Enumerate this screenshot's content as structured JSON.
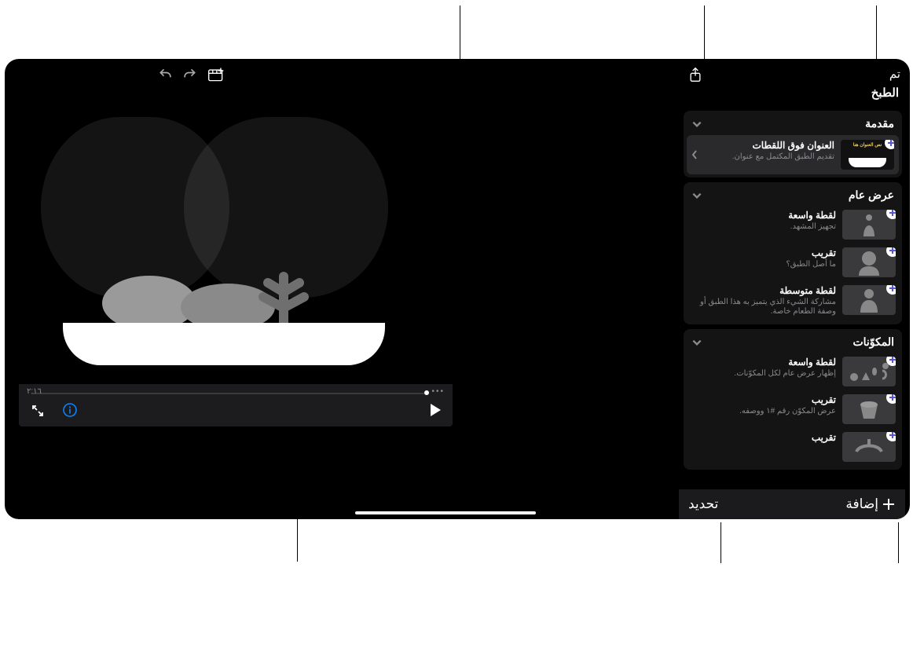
{
  "topbar": {
    "done_label": "تم",
    "project_title": "الطبخ"
  },
  "viewer": {
    "current_time": "٢:١٦",
    "end_marker": "•••"
  },
  "panelbar": {
    "add_label": "إضافة",
    "select_label": "تحديد"
  },
  "groups": [
    {
      "title": "مقدمة",
      "shots": [
        {
          "title": "العنوان فوق اللقطات",
          "sub": "تقديم الطبق المكتمل مع عنوان.",
          "thumb": "title",
          "selected": true
        }
      ]
    },
    {
      "title": "عرض عام",
      "shots": [
        {
          "title": "لقطة واسعة",
          "sub": "تجهيز المشهد.",
          "thumb": "wide"
        },
        {
          "title": "تقريب",
          "sub": "ما أصل الطبق؟",
          "thumb": "close"
        },
        {
          "title": "لقطة متوسطة",
          "sub": "مشاركة الشيء الذي يتميز به هذا الطبق أو وصفة الطعام خاصة.",
          "thumb": "medium"
        }
      ]
    },
    {
      "title": "المكوّنات",
      "shots": [
        {
          "title": "لقطة واسعة",
          "sub": "إظهار عرض عام لكل المكوّنات.",
          "thumb": "ingredients"
        },
        {
          "title": "تقريب",
          "sub": "عرض المكوّن رقم #١ ووصفه.",
          "thumb": "ing1"
        },
        {
          "title": "تقريب",
          "sub": "",
          "thumb": "ing2"
        }
      ]
    }
  ],
  "thumb_labels": {
    "title_text": "نص العنوان هنا"
  }
}
